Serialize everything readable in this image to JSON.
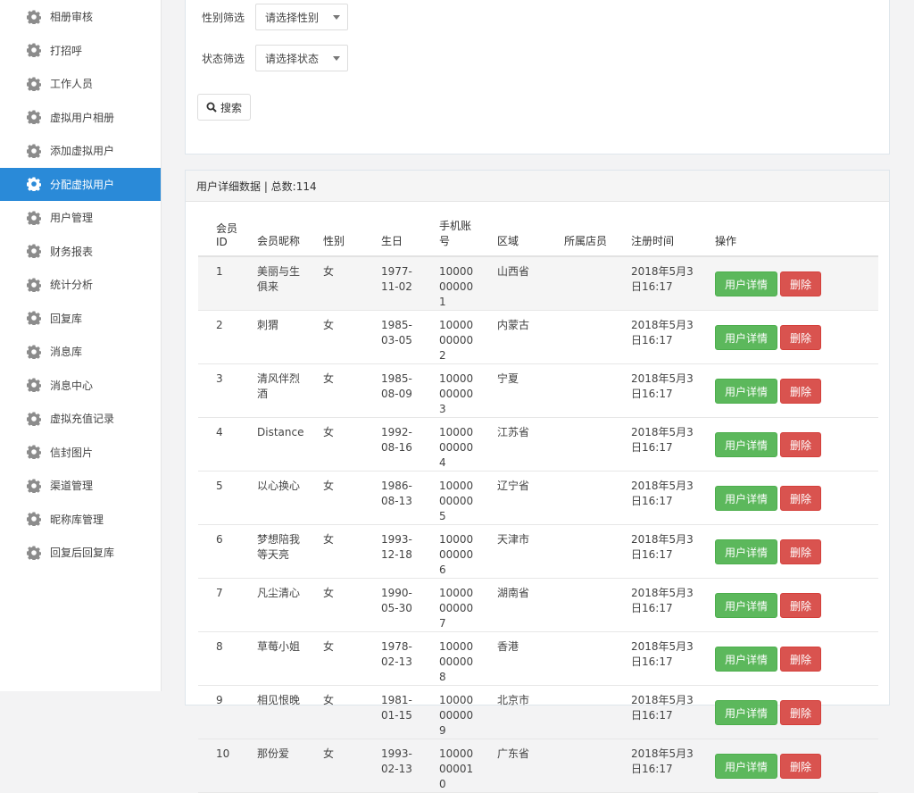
{
  "sidebar": {
    "items": [
      {
        "label": "相册审核"
      },
      {
        "label": "打招呼"
      },
      {
        "label": "工作人员"
      },
      {
        "label": "虚拟用户相册"
      },
      {
        "label": "添加虚拟用户"
      },
      {
        "label": "分配虚拟用户",
        "active": true
      },
      {
        "label": "用户管理"
      },
      {
        "label": "财务报表"
      },
      {
        "label": "统计分析"
      },
      {
        "label": "回复库"
      },
      {
        "label": "消息库"
      },
      {
        "label": "消息中心"
      },
      {
        "label": "虚拟充值记录"
      },
      {
        "label": "信封图片"
      },
      {
        "label": "渠道管理"
      },
      {
        "label": "昵称库管理"
      },
      {
        "label": "回复后回复库"
      }
    ]
  },
  "filters": {
    "gender_label": "性别筛选",
    "gender_value": "请选择性别",
    "status_label": "状态筛选",
    "status_value": "请选择状态",
    "search_label": "搜索"
  },
  "panel": {
    "title": "用户详细数据 | 总数:114"
  },
  "table": {
    "columns": [
      "会员ID",
      "会员昵称",
      "性别",
      "生日",
      "手机账号",
      "区域",
      "所属店员",
      "注册时间",
      "操作"
    ],
    "detail_label": "用户详情",
    "delete_label": "删除",
    "rows": [
      {
        "id": "1",
        "nickname": "美丽与生俱来",
        "gender": "女",
        "birthday": "1977-11-02",
        "phone": "10000000001",
        "region": "山西省",
        "staff": "",
        "reg_time": "2018年5月3日16:17"
      },
      {
        "id": "2",
        "nickname": "刺猬",
        "gender": "女",
        "birthday": "1985-03-05",
        "phone": "10000000002",
        "region": "内蒙古",
        "staff": "",
        "reg_time": "2018年5月3日16:17"
      },
      {
        "id": "3",
        "nickname": "清风伴烈酒",
        "gender": "女",
        "birthday": "1985-08-09",
        "phone": "10000000003",
        "region": "宁夏",
        "staff": "",
        "reg_time": "2018年5月3日16:17"
      },
      {
        "id": "4",
        "nickname": "Distance",
        "gender": "女",
        "birthday": "1992-08-16",
        "phone": "10000000004",
        "region": "江苏省",
        "staff": "",
        "reg_time": "2018年5月3日16:17"
      },
      {
        "id": "5",
        "nickname": "以心换心",
        "gender": "女",
        "birthday": "1986-08-13",
        "phone": "10000000005",
        "region": "辽宁省",
        "staff": "",
        "reg_time": "2018年5月3日16:17"
      },
      {
        "id": "6",
        "nickname": "梦想陪我等天亮",
        "gender": "女",
        "birthday": "1993-12-18",
        "phone": "10000000006",
        "region": "天津市",
        "staff": "",
        "reg_time": "2018年5月3日16:17"
      },
      {
        "id": "7",
        "nickname": "凡尘清心",
        "gender": "女",
        "birthday": "1990-05-30",
        "phone": "10000000007",
        "region": "湖南省",
        "staff": "",
        "reg_time": "2018年5月3日16:17"
      },
      {
        "id": "8",
        "nickname": "草莓小姐",
        "gender": "女",
        "birthday": "1978-02-13",
        "phone": "10000000008",
        "region": "香港",
        "staff": "",
        "reg_time": "2018年5月3日16:17"
      },
      {
        "id": "9",
        "nickname": "相见恨晚",
        "gender": "女",
        "birthday": "1981-01-15",
        "phone": "10000000009",
        "region": "北京市",
        "staff": "",
        "reg_time": "2018年5月3日16:17"
      },
      {
        "id": "10",
        "nickname": "那份爱",
        "gender": "女",
        "birthday": "1993-02-13",
        "phone": "10000000010",
        "region": "广东省",
        "staff": "",
        "reg_time": "2018年5月3日16:17"
      }
    ]
  }
}
